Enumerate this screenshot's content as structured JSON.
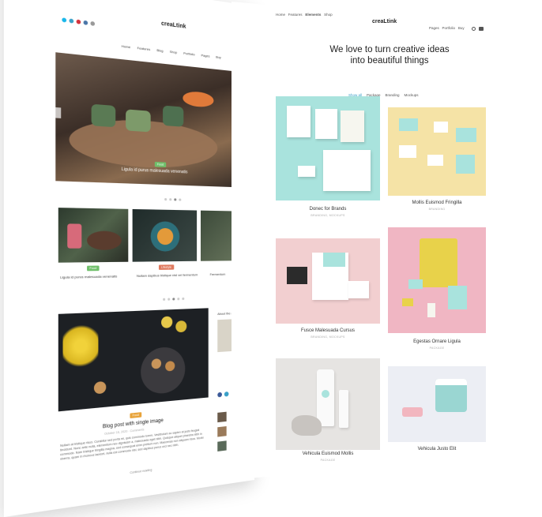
{
  "back_page": {
    "logo_text": "creaLtink",
    "social_icons": [
      "vimeo-icon",
      "twitter-icon",
      "pinterest-icon",
      "vk-icon",
      "x-icon"
    ],
    "nav": [
      "Home",
      "Features",
      "Blog",
      "Shop",
      "Portfolio",
      "Pages",
      "Buy"
    ],
    "slider_tag": "Food",
    "slider_title": "Ligula id purus malesuada venenatis",
    "cards": [
      {
        "tag": "Food",
        "title": "Ligula id purus malesuada venenatis"
      },
      {
        "tag": "Lifestyle",
        "title": "Nullam dapibus tristique nisl vel fermentum"
      },
      {
        "tag": "",
        "title": "Fermentum"
      }
    ],
    "post_tag": "Food",
    "post_title": "Blog post with single image",
    "post_meta": "October 16, 2020 · Comments",
    "post_excerpt": "Nullam at tristique risus. Curabitur sed porta mi, quis commodo lorem. Vestibulum ac sapien at justo feugiat tincidunt. Nunc ante nulla, elementum nec dignissim a, malesuada eget nibh. Quisque aliquet pharetra nibh in commodo. Nam tristique fringilla magna, sed consequat enim pretium non. Maecenas non aliquam risus. Morbi viverra, quam in rhoncus laoreet, nulla est commodo nisi, sed dapibus purus orci nec nibh.",
    "post_more": "Continue reading",
    "sidebar_heading": "About the author"
  },
  "front_page": {
    "logo_text": "creaLtink",
    "nav_left": [
      "Home",
      "Features",
      "Elements",
      "Shop"
    ],
    "nav_right": [
      "Pages",
      "Portfolio",
      "Buy"
    ],
    "heading_line1": "We love to turn creative ideas",
    "heading_line2": "into beautiful things",
    "filters": [
      "Show all",
      "Package",
      "Branding",
      "Mockups"
    ],
    "cards": [
      {
        "title": "Donec for Brands",
        "subtitle": "BRANDING, MOCKUPS"
      },
      {
        "title": "Mollis Euismod Fringilla",
        "subtitle": "BRANDING"
      },
      {
        "title": "Fusce Malesuada Cursus",
        "subtitle": "BRANDING, MOCKUPS"
      },
      {
        "title": "Egestas Ornare Ligula",
        "subtitle": "PACKAGE"
      },
      {
        "title": "Vehicula Euismod Mollis",
        "subtitle": "PACKAGE"
      },
      {
        "title": "Vehicula Justo Elit",
        "subtitle": "PACKAGE"
      }
    ]
  },
  "colors": {
    "teal": "#a9e3dd",
    "butter": "#f5e3a6",
    "blush": "#f2cfd0",
    "pink": "#f0b6c3",
    "grey_bg": "#e6e4e2",
    "mist": "#eceef4",
    "accent_blue": "#3aa0c8"
  }
}
